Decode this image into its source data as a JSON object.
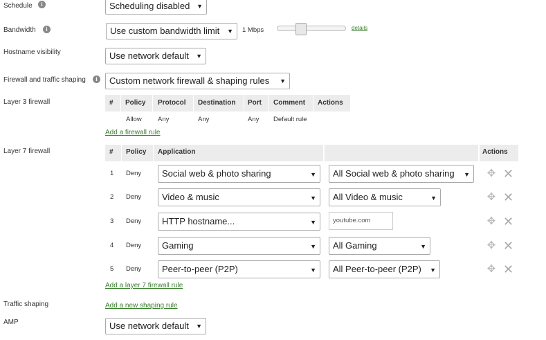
{
  "schedule": {
    "label": "Schedule",
    "value": "Scheduling disabled"
  },
  "bandwidth": {
    "label": "Bandwidth",
    "value": "Use custom bandwidth limit",
    "limit_text": "1 Mbps",
    "slider_level": 0.33,
    "details_link": "details"
  },
  "hostname": {
    "label": "Hostname visibility",
    "value": "Use network default"
  },
  "firewall_shaping": {
    "label": "Firewall and traffic shaping",
    "value": "Custom network firewall & shaping rules"
  },
  "l3": {
    "label": "Layer 3 firewall",
    "headers": [
      "#",
      "Policy",
      "Protocol",
      "Destination",
      "Port",
      "Comment",
      "Actions"
    ],
    "default_row": {
      "policy": "Allow",
      "protocol": "Any",
      "destination": "Any",
      "port": "Any",
      "comment": "Default rule"
    },
    "add_link": "Add a firewall rule"
  },
  "l7": {
    "label": "Layer 7 firewall",
    "headers": {
      "num": "#",
      "policy": "Policy",
      "application": "Application",
      "actions": "Actions"
    },
    "rules": [
      {
        "num": "1",
        "policy": "Deny",
        "application": "Social web & photo sharing",
        "detail": "All Social web & photo sharing",
        "detail_type": "select"
      },
      {
        "num": "2",
        "policy": "Deny",
        "application": "Video & music",
        "detail": "All Video & music",
        "detail_type": "select"
      },
      {
        "num": "3",
        "policy": "Deny",
        "application": "HTTP hostname...",
        "detail": "youtube.com",
        "detail_type": "text"
      },
      {
        "num": "4",
        "policy": "Deny",
        "application": "Gaming",
        "detail": "All Gaming",
        "detail_type": "select"
      },
      {
        "num": "5",
        "policy": "Deny",
        "application": "Peer-to-peer (P2P)",
        "detail": "All Peer-to-peer (P2P)",
        "detail_type": "select"
      }
    ],
    "add_link": "Add a layer 7 firewall rule"
  },
  "traffic_shaping": {
    "label": "Traffic shaping",
    "add_link": "Add a new shaping rule"
  },
  "amp": {
    "label": "AMP",
    "value": "Use network default"
  },
  "icons": {
    "info": "info-icon",
    "move": "move-icon",
    "delete": "close-icon",
    "dropdown": "chevron-down-icon"
  },
  "colors": {
    "link": "#3a7d2e",
    "header_bg": "#ececec",
    "border": "#aaaaaa"
  }
}
